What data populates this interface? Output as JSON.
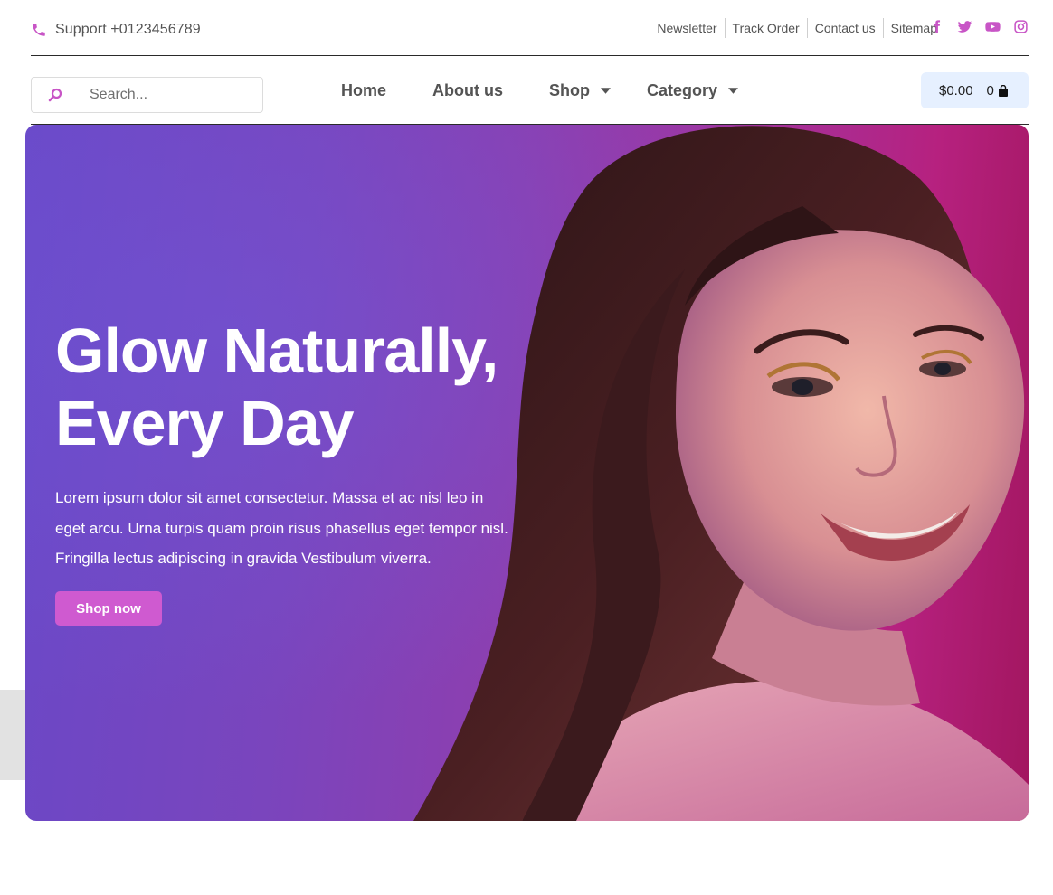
{
  "colors": {
    "accent": "#c855c6",
    "button": "#cf5ad0",
    "cart_bg": "#e6f0ff",
    "text": "#545454"
  },
  "topbar": {
    "support_icon": "phone-icon",
    "support_text": "Support +0123456789",
    "links": [
      "Newsletter",
      "Track Order",
      "Contact us",
      "Sitemap"
    ],
    "socials": [
      "facebook-icon",
      "twitter-icon",
      "youtube-icon",
      "instagram-icon"
    ]
  },
  "nav": {
    "search_placeholder": "Search...",
    "menu": [
      {
        "label": "Home",
        "has_dropdown": false
      },
      {
        "label": "About us",
        "has_dropdown": false
      },
      {
        "label": "Shop",
        "has_dropdown": true
      },
      {
        "label": "Category",
        "has_dropdown": true
      }
    ],
    "cart_total": "$0.00",
    "cart_count": "0"
  },
  "hero": {
    "title_line1": "Glow Naturally,",
    "title_line2": "Every Day",
    "description": "Lorem ipsum dolor sit amet consectetur. Massa et ac nisl leo in eget arcu. Urna turpis quam proin risus phasellus eget tempor nisl. Fringilla lectus adipiscing in gravida Vestibulum viverra.",
    "button_label": "Shop now"
  }
}
